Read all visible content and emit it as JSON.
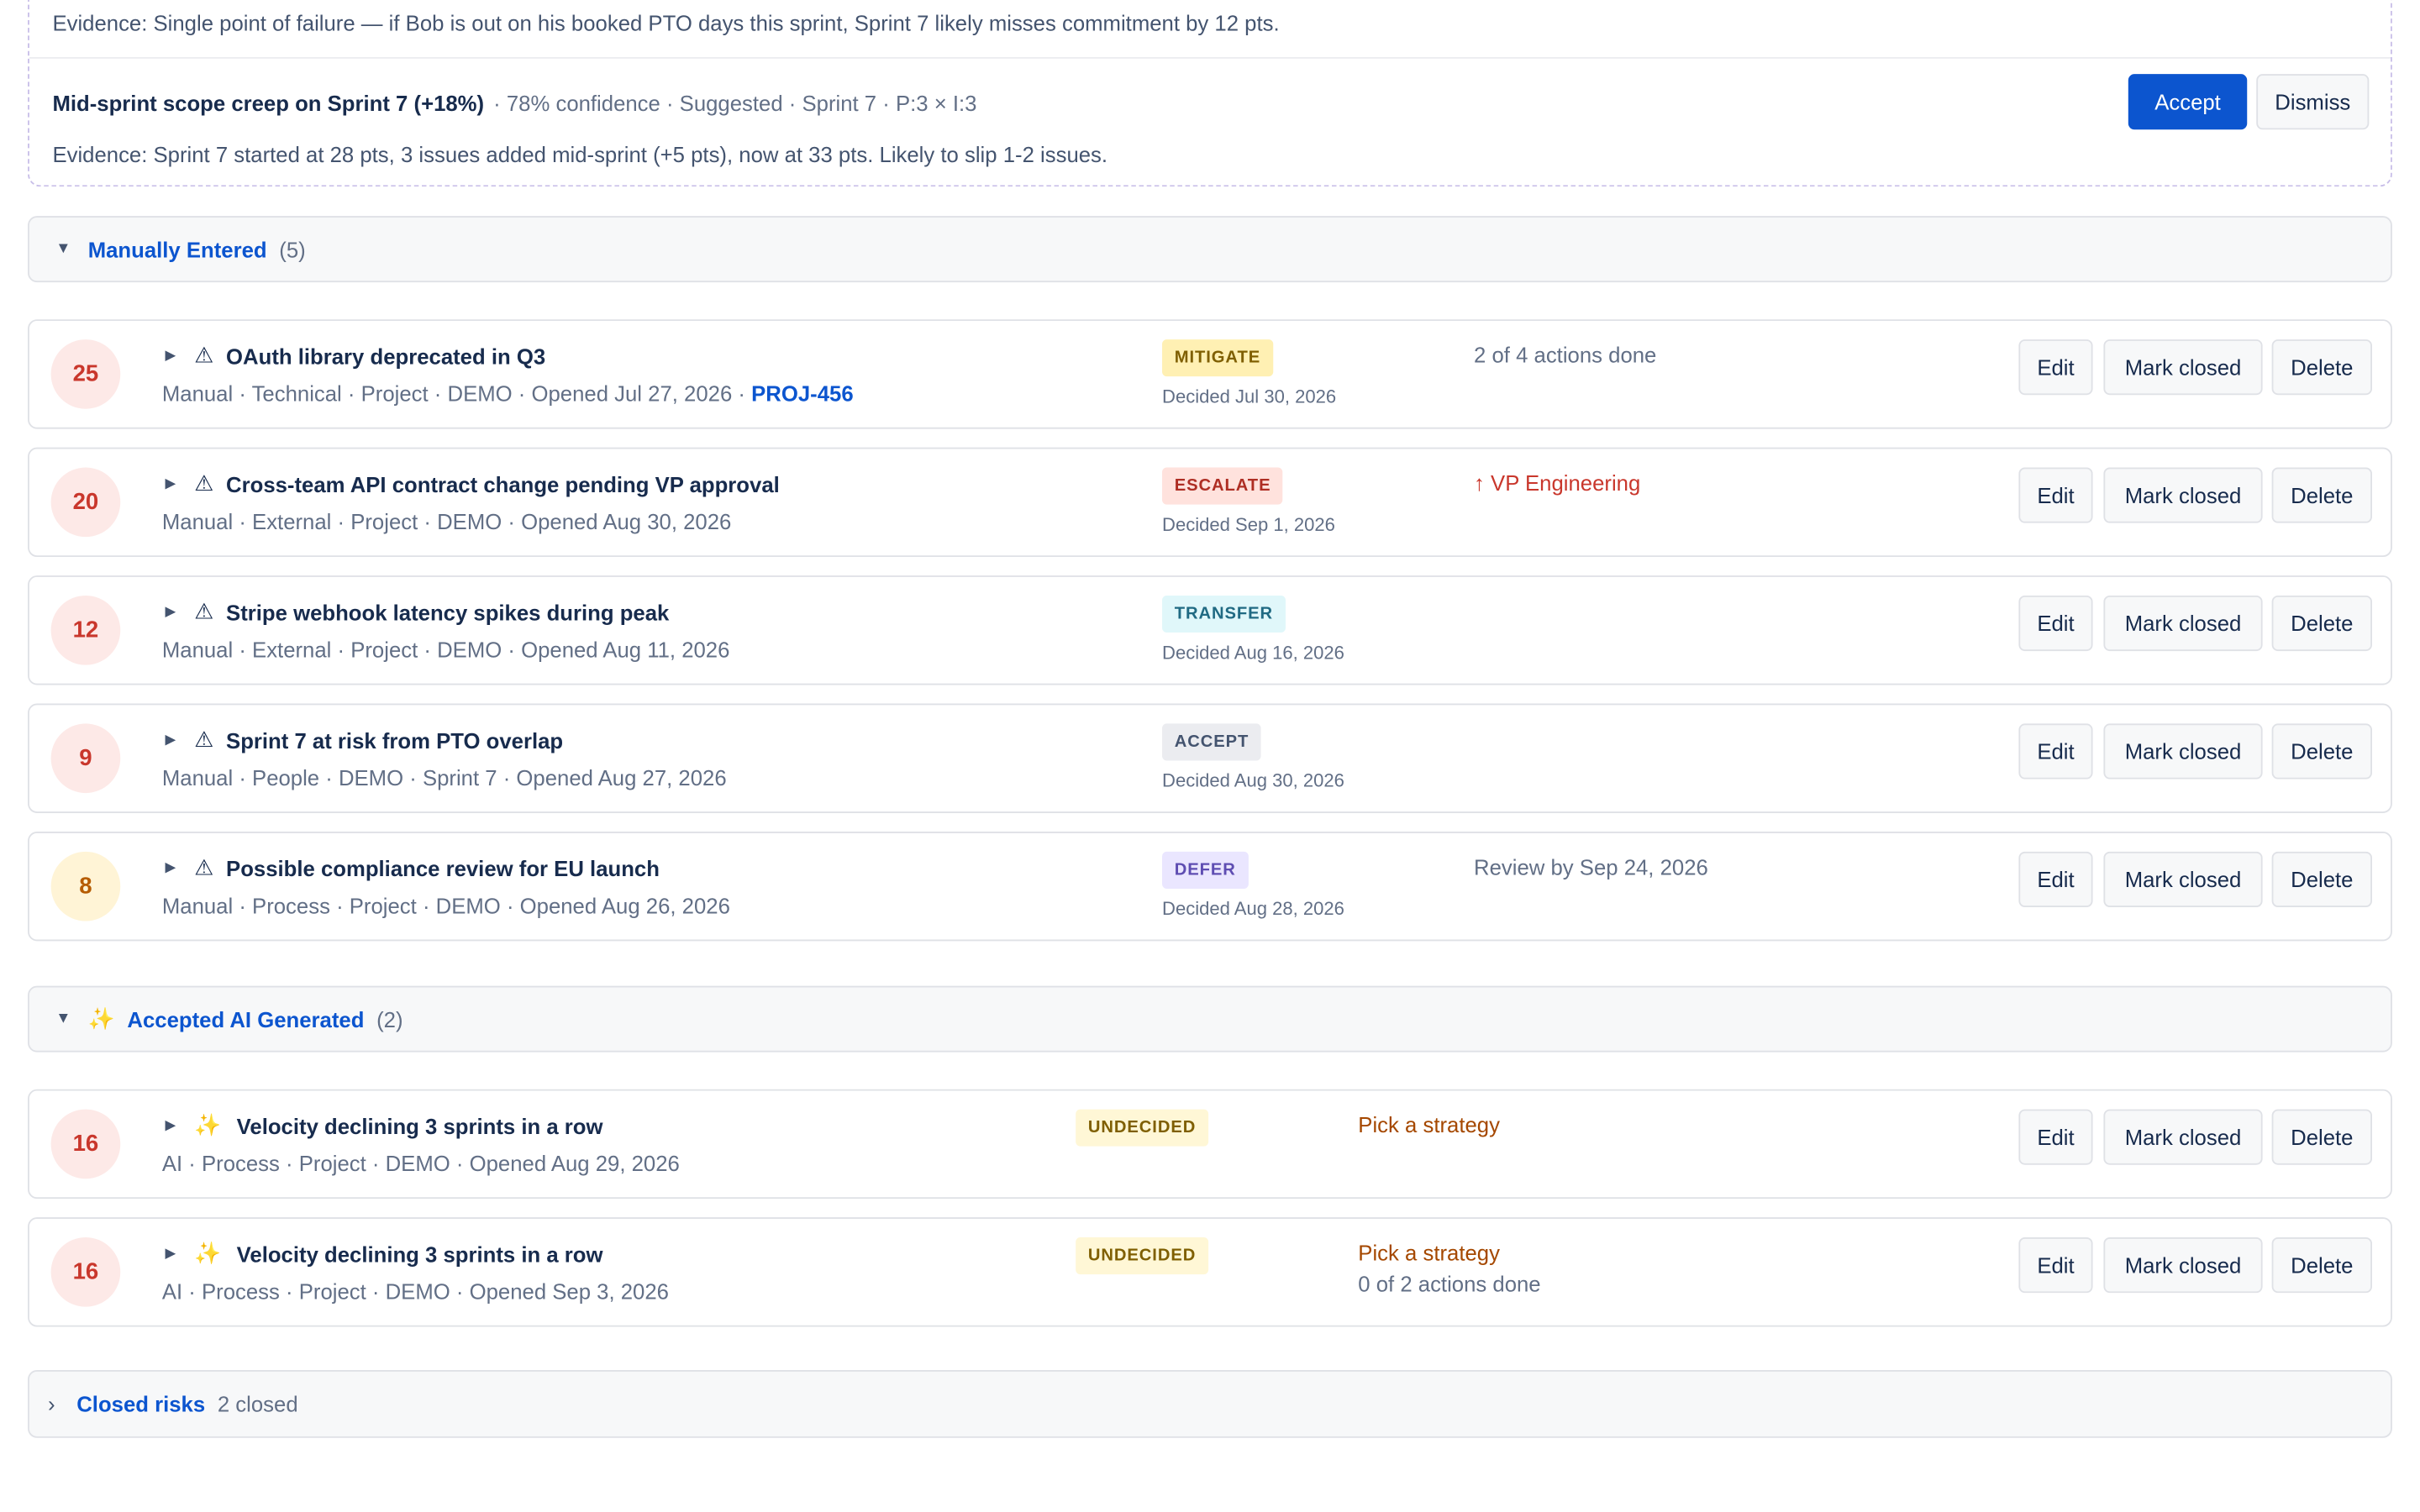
{
  "suggested": {
    "prev_evidence": "Evidence: Single point of failure — if Bob is out on his booked PTO days this sprint, Sprint 7 likely misses commitment by 12 pts.",
    "item": {
      "title": "Mid-sprint scope creep on Sprint 7 (+18%)",
      "meta": "· 78% confidence · Suggested · Sprint 7 · P:3 × I:3",
      "evidence": "Evidence: Sprint 7 started at 28 pts, 3 issues added mid-sprint (+5 pts), now at 33 pts. Likely to slip 1-2 issues.",
      "accept_label": "Accept",
      "dismiss_label": "Dismiss"
    }
  },
  "sections": {
    "manual": {
      "label": "Manually Entered",
      "count": "(5)",
      "caret": "▼"
    },
    "ai": {
      "label": "Accepted AI Generated",
      "count": "(2)",
      "caret": "▼",
      "icon": "sparkle-icon"
    }
  },
  "actions": {
    "edit": "Edit",
    "mark_closed": "Mark closed",
    "delete": "Delete"
  },
  "risks": [
    {
      "score": "25",
      "title": "OAuth library deprecated in Q3",
      "meta": "Manual · Technical · Project · DEMO · Opened Jul 27, 2026 · ",
      "link": "PROJ-456",
      "badge": "MITIGATE",
      "decided": "Decided Jul 30, 2026",
      "note": "2 of 4 actions done"
    },
    {
      "score": "20",
      "title": "Cross-team API contract change pending VP approval",
      "meta": "Manual · External · Project · DEMO · Opened Aug 30, 2026",
      "badge": "ESCALATE",
      "decided": "Decided Sep 1, 2026",
      "note": "↑ VP Engineering"
    },
    {
      "score": "12",
      "title": "Stripe webhook latency spikes during peak",
      "meta": "Manual · External · Project · DEMO · Opened Aug 11, 2026",
      "badge": "TRANSFER",
      "decided": "Decided Aug 16, 2026"
    },
    {
      "score": "9",
      "title": "Sprint 7 at risk from PTO overlap",
      "meta": "Manual · People · DEMO · Sprint 7 · Opened Aug 27, 2026",
      "badge": "ACCEPT",
      "decided": "Decided Aug 30, 2026"
    },
    {
      "score": "8",
      "title": "Possible compliance review for EU launch",
      "meta": "Manual · Process · Project · DEMO · Opened Aug 26, 2026",
      "badge": "DEFER",
      "decided": "Decided Aug 28, 2026",
      "note": "Review by Sep 24, 2026"
    }
  ],
  "ai_risks": [
    {
      "score": "16",
      "title": "Velocity declining 3 sprints in a row",
      "meta": "AI · Process · Project · DEMO · Opened Aug 29, 2026",
      "badge": "UNDECIDED",
      "note": "Pick a strategy"
    },
    {
      "score": "16",
      "title": "Velocity declining 3 sprints in a row",
      "meta": "AI · Process · Project · DEMO · Opened Sep 3, 2026",
      "badge": "UNDECIDED",
      "note": "Pick a strategy",
      "note2": "0 of 2 actions done"
    }
  ],
  "closed": {
    "label": "Closed risks",
    "count": "2 closed",
    "chevron": "›"
  },
  "colors": {
    "primary": "#0c55cf",
    "score_red": "#c9372c",
    "score_amber": "#b65c02"
  }
}
